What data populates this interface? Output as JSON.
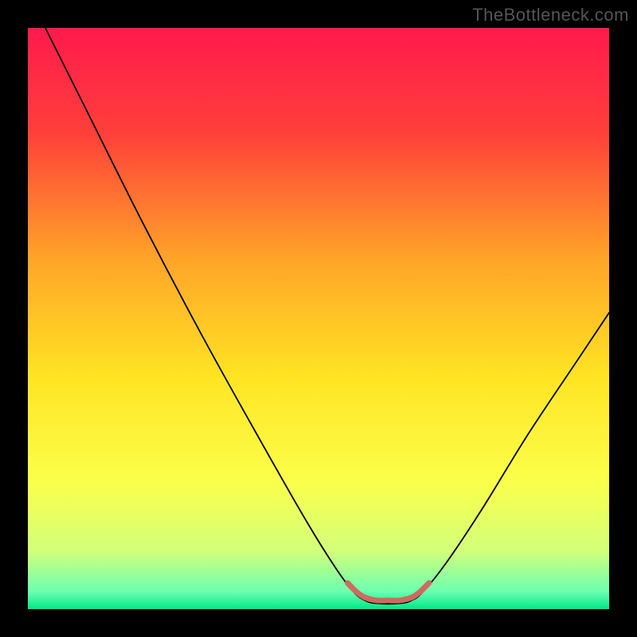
{
  "watermark": "TheBottleneck.com",
  "chart_data": {
    "type": "line",
    "title": "",
    "xlabel": "",
    "ylabel": "",
    "xlim": [
      0,
      100
    ],
    "ylim": [
      0,
      100
    ],
    "background_gradient": {
      "stops": [
        {
          "pos": 0.0,
          "color": "#ff1a4d"
        },
        {
          "pos": 0.18,
          "color": "#ff3f3a"
        },
        {
          "pos": 0.4,
          "color": "#ffa528"
        },
        {
          "pos": 0.6,
          "color": "#ffe423"
        },
        {
          "pos": 0.78,
          "color": "#fbff4a"
        },
        {
          "pos": 0.9,
          "color": "#d2ff7a"
        },
        {
          "pos": 0.97,
          "color": "#6cffb0"
        },
        {
          "pos": 1.0,
          "color": "#00e885"
        }
      ]
    },
    "series": [
      {
        "name": "bottleneck-curve",
        "color": "#000000",
        "width": 1.8,
        "points": [
          {
            "x": 3,
            "y": 100
          },
          {
            "x": 10,
            "y": 86
          },
          {
            "x": 20,
            "y": 66
          },
          {
            "x": 30,
            "y": 47
          },
          {
            "x": 40,
            "y": 29
          },
          {
            "x": 48,
            "y": 15
          },
          {
            "x": 53,
            "y": 7
          },
          {
            "x": 56,
            "y": 3
          },
          {
            "x": 58,
            "y": 1.5
          },
          {
            "x": 60,
            "y": 1
          },
          {
            "x": 64,
            "y": 1
          },
          {
            "x": 66,
            "y": 1.5
          },
          {
            "x": 68,
            "y": 3
          },
          {
            "x": 72,
            "y": 8
          },
          {
            "x": 78,
            "y": 17
          },
          {
            "x": 86,
            "y": 30
          },
          {
            "x": 94,
            "y": 42
          },
          {
            "x": 100,
            "y": 51
          }
        ]
      },
      {
        "name": "valley-highlight",
        "color": "#cc6b60",
        "width": 7,
        "points": [
          {
            "x": 55,
            "y": 4.5
          },
          {
            "x": 56.5,
            "y": 3
          },
          {
            "x": 58,
            "y": 2
          },
          {
            "x": 60,
            "y": 1.5
          },
          {
            "x": 62,
            "y": 1.5
          },
          {
            "x": 64,
            "y": 1.5
          },
          {
            "x": 66,
            "y": 2
          },
          {
            "x": 67.5,
            "y": 3
          },
          {
            "x": 69,
            "y": 4.5
          }
        ]
      }
    ]
  }
}
